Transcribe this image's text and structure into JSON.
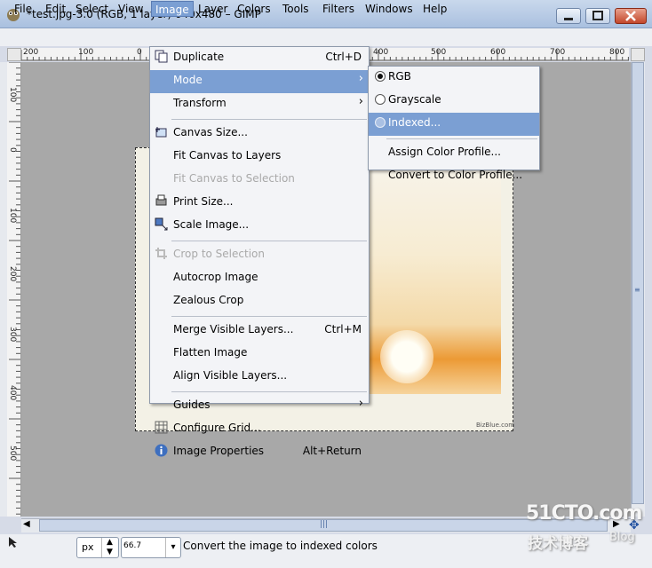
{
  "window": {
    "title": "*test.jpg-3.0 (RGB, 1 layer) 640x480 – GIMP"
  },
  "menubar": {
    "items": [
      {
        "label": "File"
      },
      {
        "label": "Edit"
      },
      {
        "label": "Select"
      },
      {
        "label": "View"
      },
      {
        "label": "Image"
      },
      {
        "label": "Layer"
      },
      {
        "label": "Colors"
      },
      {
        "label": "Tools"
      },
      {
        "label": "Filters"
      },
      {
        "label": "Windows"
      },
      {
        "label": "Help"
      }
    ],
    "active": "Image"
  },
  "image_menu": {
    "items": [
      {
        "label": "Duplicate",
        "shortcut": "Ctrl+D",
        "icon": "duplicate-icon"
      },
      {
        "label": "Mode",
        "submenu": true,
        "highlighted": true
      },
      {
        "label": "Transform",
        "submenu": true
      },
      {
        "label": "Canvas Size...",
        "icon": "canvas-size-icon"
      },
      {
        "label": "Fit Canvas to Layers"
      },
      {
        "label": "Fit Canvas to Selection",
        "disabled": true
      },
      {
        "label": "Print Size...",
        "icon": "print-size-icon"
      },
      {
        "label": "Scale Image...",
        "icon": "scale-image-icon"
      },
      {
        "label": "Crop to Selection",
        "disabled": true,
        "icon": "crop-icon"
      },
      {
        "label": "Autocrop Image"
      },
      {
        "label": "Zealous Crop"
      },
      {
        "label": "Merge Visible Layers...",
        "shortcut": "Ctrl+M"
      },
      {
        "label": "Flatten Image"
      },
      {
        "label": "Align Visible Layers..."
      },
      {
        "label": "Guides",
        "submenu": true
      },
      {
        "label": "Configure Grid...",
        "icon": "grid-icon"
      },
      {
        "label": "Image Properties",
        "shortcut": "Alt+Return",
        "icon": "info-icon"
      }
    ]
  },
  "mode_menu": {
    "items": [
      {
        "label": "RGB",
        "selected": true
      },
      {
        "label": "Grayscale",
        "selected": false
      },
      {
        "label": "Indexed...",
        "selected": false,
        "highlighted": true
      },
      {
        "label": "Assign Color Profile..."
      },
      {
        "label": "Convert to Color Profile..."
      }
    ]
  },
  "rulers": {
    "horizontal_labels": [
      "200",
      "100",
      "0",
      "400",
      "500",
      "600",
      "700",
      "800"
    ],
    "vertical_labels": [
      "100",
      "0",
      "100",
      "200",
      "300",
      "400",
      "500"
    ]
  },
  "statusbar": {
    "unit": "px",
    "zoom": "66.7",
    "message": "Convert the image to indexed colors"
  },
  "watermark": {
    "photo_text": "BizBlue.com",
    "site_logo": "51CTO.com",
    "site_tagline": "技术博客",
    "blog_label": "Blog"
  },
  "colors": {
    "menu_highlight": "#7b9fd3",
    "canvas_bg": "#a8a8a8",
    "menu_bg": "#f3f4f7"
  }
}
